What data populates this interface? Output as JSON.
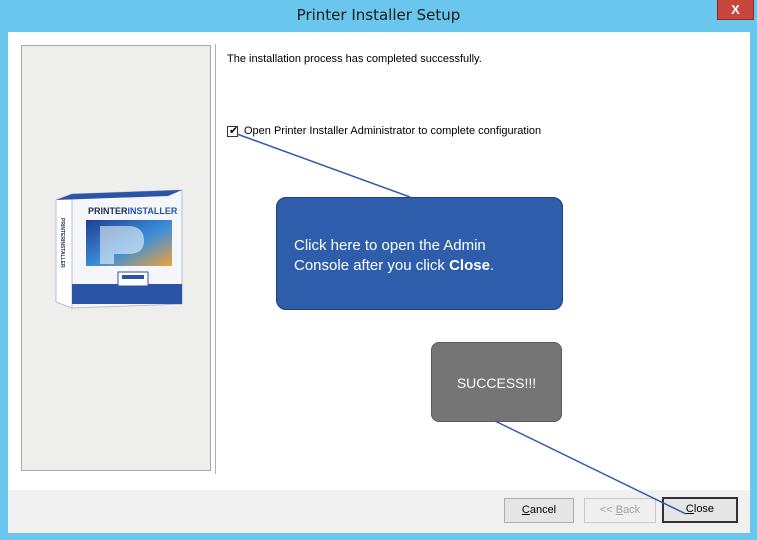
{
  "window": {
    "title": "Printer Installer Setup",
    "close_glyph": "X"
  },
  "content": {
    "message": "The installation process has completed successfully.",
    "checkbox": {
      "label": "Open Printer Installer Administrator to complete configuration",
      "checked": true,
      "mark": "✔"
    }
  },
  "buttons": {
    "cancel_prefix": "",
    "cancel_mnemonic": "C",
    "cancel_rest": "ancel",
    "back_prefix": "<< ",
    "back_mnemonic": "B",
    "back_rest": "ack",
    "close_mnemonic": "C",
    "close_rest": "lose"
  },
  "callouts": {
    "admin_line1": "Click here to open the Admin",
    "admin_line2_prefix": "Console after you click ",
    "admin_line2_bold": "Close",
    "admin_line2_suffix": ".",
    "success": "SUCCESS!!!"
  },
  "product": {
    "box_title_a": "PRINTER",
    "box_title_b": "INSTALLER",
    "box_spine": "PRINTERINSTALLER"
  },
  "colors": {
    "titlebar": "#6bc6ee",
    "callout_blue": "#2e5dac",
    "callout_gray": "#757575",
    "close_button": "#c9463d"
  }
}
